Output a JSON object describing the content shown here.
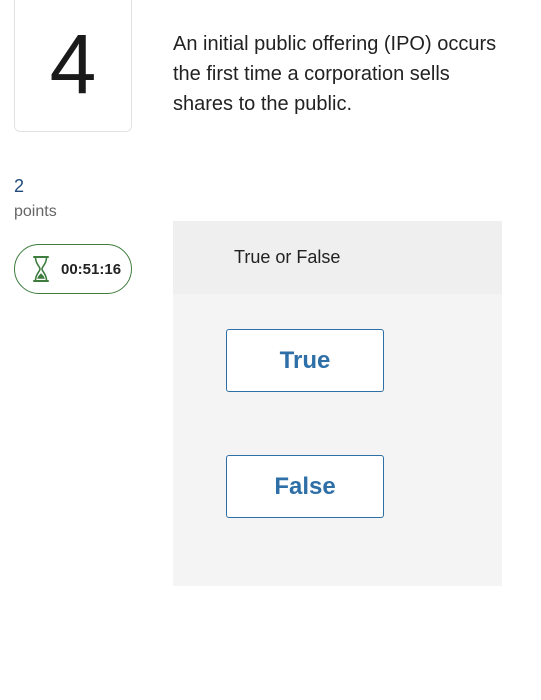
{
  "question": {
    "number": "4",
    "text": "An initial public offering (IPO) occurs the first time a corporation sells shares to the public.",
    "points_value": "2",
    "points_label": "points"
  },
  "timer": {
    "icon": "hourglass-icon",
    "time": "00:51:16",
    "color": "#3e7d3e"
  },
  "answer_panel": {
    "header": "True or False",
    "options": [
      {
        "label": "True"
      },
      {
        "label": "False"
      }
    ],
    "accent_color": "#2e6fa7"
  }
}
